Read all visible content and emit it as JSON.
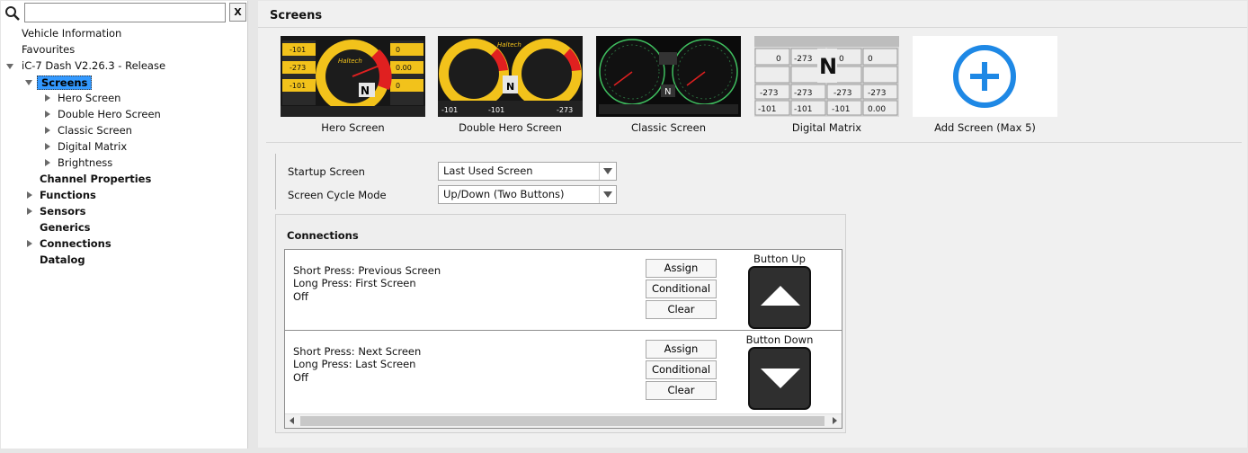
{
  "search": {
    "value": "",
    "clear_label": "X"
  },
  "tree": {
    "vehicle_information": "Vehicle Information",
    "favourites": "Favourites",
    "device": "iC-7 Dash V2.26.3 - Release",
    "screens": "Screens",
    "hero_screen": "Hero Screen",
    "double_hero_screen": "Double Hero Screen",
    "classic_screen": "Classic Screen",
    "digital_matrix": "Digital Matrix",
    "brightness": "Brightness",
    "channel_properties": "Channel Properties",
    "functions": "Functions",
    "sensors": "Sensors",
    "generics": "Generics",
    "connections": "Connections",
    "datalog": "Datalog"
  },
  "main": {
    "title": "Screens",
    "cards": [
      {
        "label": "Hero Screen"
      },
      {
        "label": "Double Hero Screen"
      },
      {
        "label": "Classic Screen"
      },
      {
        "label": "Digital Matrix"
      },
      {
        "label": "Add Screen (Max 5)"
      }
    ],
    "thumb_text": {
      "v101": "-101",
      "v273": "-273",
      "v000": "0.00",
      "v0": "0",
      "gear": "N",
      "brand": "Haltech"
    },
    "startup_label": "Startup Screen",
    "startup_value": "Last Used Screen",
    "cycle_label": "Screen Cycle Mode",
    "cycle_value": "Up/Down (Two Buttons)",
    "connections_title": "Connections",
    "rows": [
      {
        "short": "Short Press: Previous Screen",
        "long": "Long Press: First Screen",
        "state": "Off",
        "assign": "Assign",
        "conditional": "Conditional",
        "clear": "Clear",
        "button_label": "Button Up"
      },
      {
        "short": "Short Press: Next Screen",
        "long": "Long Press: Last Screen",
        "state": "Off",
        "assign": "Assign",
        "conditional": "Conditional",
        "clear": "Clear",
        "button_label": "Button Down"
      }
    ]
  },
  "colors": {
    "selection": "#3399ff",
    "add_circle": "#1e88e5",
    "hero_yellow": "#f2c21b",
    "hero_red": "#e02020",
    "classic_green": "#3fbf5f"
  }
}
